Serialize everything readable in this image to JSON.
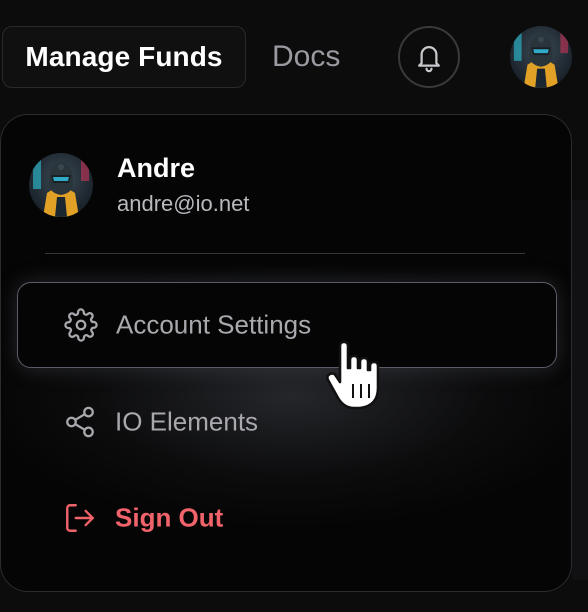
{
  "header": {
    "manage_funds_label": "Manage Funds",
    "docs_label": "Docs",
    "notifications_icon": "bell-icon"
  },
  "profile": {
    "name": "Andre",
    "email": "andre@io.net"
  },
  "menu": {
    "items": [
      {
        "label": "Account Settings",
        "icon": "gear-icon",
        "state": "hovered"
      },
      {
        "label": "IO Elements",
        "icon": "share-icon",
        "state": "default"
      },
      {
        "label": "Sign Out",
        "icon": "sign-out-icon",
        "state": "default"
      }
    ]
  },
  "colors": {
    "background": "#0c0c0d",
    "dropdown_bg": "#050505",
    "primary_text": "#ffffff",
    "muted_text": "#a8a8ad",
    "danger": "#f0636b",
    "border": "#2c2c2f"
  }
}
